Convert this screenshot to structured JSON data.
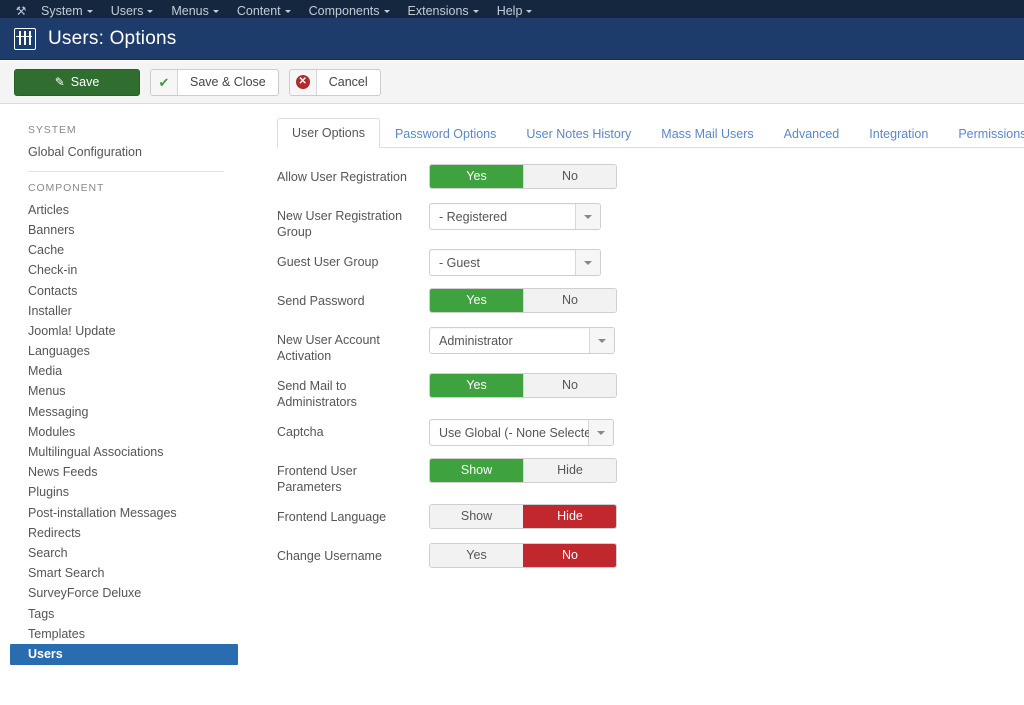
{
  "admin_menu": {
    "logo_icon": "joomla-logo-icon",
    "items": [
      {
        "label": "System"
      },
      {
        "label": "Users"
      },
      {
        "label": "Menus"
      },
      {
        "label": "Content"
      },
      {
        "label": "Components"
      },
      {
        "label": "Extensions"
      },
      {
        "label": "Help"
      }
    ]
  },
  "header": {
    "title": "Users: Options",
    "icon": "users-grid-icon",
    "bg_color": "#1d3c6b"
  },
  "toolbar": {
    "save_label": "Save",
    "save_icon": "pencil-square-icon",
    "save_close_label": "Save & Close",
    "save_close_icon": "check-icon",
    "cancel_label": "Cancel",
    "cancel_icon": "cancel-circle-icon"
  },
  "sidebar": {
    "system_heading": "SYSTEM",
    "system_items": [
      {
        "label": "Global Configuration"
      }
    ],
    "component_heading": "COMPONENT",
    "component_items": [
      {
        "label": "Articles",
        "active": false
      },
      {
        "label": "Banners",
        "active": false
      },
      {
        "label": "Cache",
        "active": false
      },
      {
        "label": "Check-in",
        "active": false
      },
      {
        "label": "Contacts",
        "active": false
      },
      {
        "label": "Installer",
        "active": false
      },
      {
        "label": "Joomla! Update",
        "active": false
      },
      {
        "label": "Languages",
        "active": false
      },
      {
        "label": "Media",
        "active": false
      },
      {
        "label": "Menus",
        "active": false
      },
      {
        "label": "Messaging",
        "active": false
      },
      {
        "label": "Modules",
        "active": false
      },
      {
        "label": "Multilingual Associations",
        "active": false
      },
      {
        "label": "News Feeds",
        "active": false
      },
      {
        "label": "Plugins",
        "active": false
      },
      {
        "label": "Post-installation Messages",
        "active": false
      },
      {
        "label": "Redirects",
        "active": false
      },
      {
        "label": "Search",
        "active": false
      },
      {
        "label": "Smart Search",
        "active": false
      },
      {
        "label": "SurveyForce Deluxe",
        "active": false
      },
      {
        "label": "Tags",
        "active": false
      },
      {
        "label": "Templates",
        "active": false
      },
      {
        "label": "Users",
        "active": true
      }
    ],
    "active_color": "#2a6cb0"
  },
  "tabs": [
    {
      "label": "User Options",
      "active": true
    },
    {
      "label": "Password Options",
      "active": false
    },
    {
      "label": "User Notes History",
      "active": false
    },
    {
      "label": "Mass Mail Users",
      "active": false
    },
    {
      "label": "Advanced",
      "active": false
    },
    {
      "label": "Integration",
      "active": false
    },
    {
      "label": "Permissions",
      "active": false
    }
  ],
  "colors": {
    "toggle_on_green": "#3ea23e",
    "toggle_on_red": "#c0282d",
    "toggle_off": "#f2f2f2",
    "save_green": "#306e30"
  },
  "form": {
    "rows": [
      {
        "label": "Allow User Registration",
        "type": "toggle",
        "options": [
          "Yes",
          "No"
        ],
        "selected": "Yes",
        "state": "green"
      },
      {
        "label": "New User Registration Group",
        "type": "select",
        "value": "- Registered"
      },
      {
        "label": "Guest User Group",
        "type": "select",
        "value": "- Guest"
      },
      {
        "label": "Send Password",
        "type": "toggle",
        "options": [
          "Yes",
          "No"
        ],
        "selected": "Yes",
        "state": "green"
      },
      {
        "label": "New User Account Activation",
        "type": "select",
        "value": "Administrator"
      },
      {
        "label": "Send Mail to Administrators",
        "type": "toggle",
        "options": [
          "Yes",
          "No"
        ],
        "selected": "Yes",
        "state": "green"
      },
      {
        "label": "Captcha",
        "type": "select",
        "value": "Use Global (- None Selected -)"
      },
      {
        "label": "Frontend User Parameters",
        "type": "toggle",
        "options": [
          "Show",
          "Hide"
        ],
        "selected": "Show",
        "state": "green"
      },
      {
        "label": "Frontend Language",
        "type": "toggle",
        "options": [
          "Show",
          "Hide"
        ],
        "selected": "Hide",
        "state": "red"
      },
      {
        "label": "Change Username",
        "type": "toggle",
        "options": [
          "Yes",
          "No"
        ],
        "selected": "No",
        "state": "red"
      }
    ]
  }
}
